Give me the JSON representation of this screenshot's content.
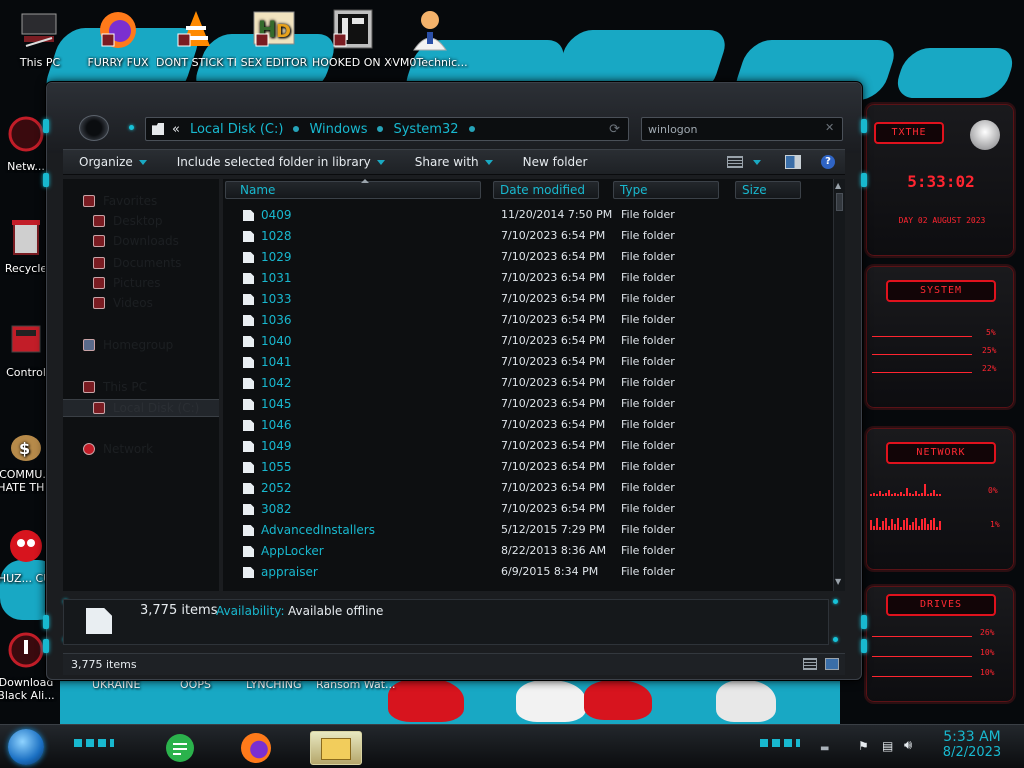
{
  "desktop": {
    "icons": [
      {
        "label": "This PC",
        "icon": "computer-icon"
      },
      {
        "label": "FURRY FUX",
        "icon": "firefox-icon"
      },
      {
        "label": "DONT STICK THIS IN YO...",
        "icon": "vlc-icon"
      },
      {
        "label": "SEX EDITOR",
        "icon": "hxd-editor-icon"
      },
      {
        "label": "HOOKED ON XONIX",
        "icon": "xonix-game-icon"
      },
      {
        "label": "VM0Technic...",
        "icon": "doctor-icon"
      },
      {
        "label": "Netw...",
        "icon": "network-icon"
      },
      {
        "label": "Recycle",
        "icon": "recycle-bin-icon"
      },
      {
        "label": "Control",
        "icon": "control-panel-icon"
      },
      {
        "label": "COMMU... HATE TH...",
        "icon": "money-bag-icon"
      },
      {
        "label": "CHUZ... CU...",
        "icon": "red-character-icon"
      },
      {
        "label": "Download Black Ali...",
        "icon": "download-icon"
      }
    ],
    "bottom_labels": [
      "UKRAINE",
      "OOPS",
      "LYNCHING",
      "Ransom Wat..."
    ]
  },
  "widget": {
    "time_label": "TXTHE",
    "clock": "5:33:02",
    "date": "DAY 02 AUGUST 2023",
    "system": {
      "header": "SYSTEM",
      "values": [
        "5%",
        "25%",
        "22%"
      ]
    },
    "network": {
      "header": "NETWORK",
      "values": [
        "0%",
        "1%"
      ]
    },
    "drives": {
      "header": "DRIVES",
      "values": [
        "26%",
        "10%",
        "10%"
      ]
    }
  },
  "explorer": {
    "address": {
      "back_glyph": "«",
      "crumbs": [
        "Local Disk (C:)",
        "Windows",
        "System32"
      ]
    },
    "search": {
      "value": "winlogon"
    },
    "toolbar": {
      "organize": "Organize",
      "include": "Include selected folder in library",
      "share": "Share with",
      "new_folder": "New folder"
    },
    "nav": [
      "Favorites",
      "Desktop",
      "Downloads",
      "Documents",
      "Pictures",
      "Videos",
      "Homegroup",
      "This PC",
      "Local Disk (C:)",
      "Network"
    ],
    "columns": {
      "name": "Name",
      "date": "Date modified",
      "type": "Type",
      "size": "Size"
    },
    "files": [
      {
        "name": "0409",
        "date": "11/20/2014 7:50 PM",
        "type": "File folder"
      },
      {
        "name": "1028",
        "date": "7/10/2023 6:54 PM",
        "type": "File folder"
      },
      {
        "name": "1029",
        "date": "7/10/2023 6:54 PM",
        "type": "File folder"
      },
      {
        "name": "1031",
        "date": "7/10/2023 6:54 PM",
        "type": "File folder"
      },
      {
        "name": "1033",
        "date": "7/10/2023 6:54 PM",
        "type": "File folder"
      },
      {
        "name": "1036",
        "date": "7/10/2023 6:54 PM",
        "type": "File folder"
      },
      {
        "name": "1040",
        "date": "7/10/2023 6:54 PM",
        "type": "File folder"
      },
      {
        "name": "1041",
        "date": "7/10/2023 6:54 PM",
        "type": "File folder"
      },
      {
        "name": "1042",
        "date": "7/10/2023 6:54 PM",
        "type": "File folder"
      },
      {
        "name": "1045",
        "date": "7/10/2023 6:54 PM",
        "type": "File folder"
      },
      {
        "name": "1046",
        "date": "7/10/2023 6:54 PM",
        "type": "File folder"
      },
      {
        "name": "1049",
        "date": "7/10/2023 6:54 PM",
        "type": "File folder"
      },
      {
        "name": "1055",
        "date": "7/10/2023 6:54 PM",
        "type": "File folder"
      },
      {
        "name": "2052",
        "date": "7/10/2023 6:54 PM",
        "type": "File folder"
      },
      {
        "name": "3082",
        "date": "7/10/2023 6:54 PM",
        "type": "File folder"
      },
      {
        "name": "AdvancedInstallers",
        "date": "5/12/2015 7:29 PM",
        "type": "File folder"
      },
      {
        "name": "AppLocker",
        "date": "8/22/2013 8:36 AM",
        "type": "File folder"
      },
      {
        "name": "appraiser",
        "date": "6/9/2015 8:34 PM",
        "type": "File folder"
      }
    ],
    "details": {
      "count": "3,775 items",
      "availability_label": "Availability:",
      "availability_value": "Available offline"
    },
    "status": {
      "count": "3,775 items"
    }
  },
  "taskbar": {
    "clock_time": "5:33 AM",
    "clock_date": "8/2/2023",
    "apps": [
      "feedly-icon",
      "firefox-icon",
      "file-explorer-icon"
    ]
  },
  "colors": {
    "accent": "#18b8cf",
    "widget_red": "#ff2530",
    "wallpaper_cyan": "#18a8c4"
  }
}
